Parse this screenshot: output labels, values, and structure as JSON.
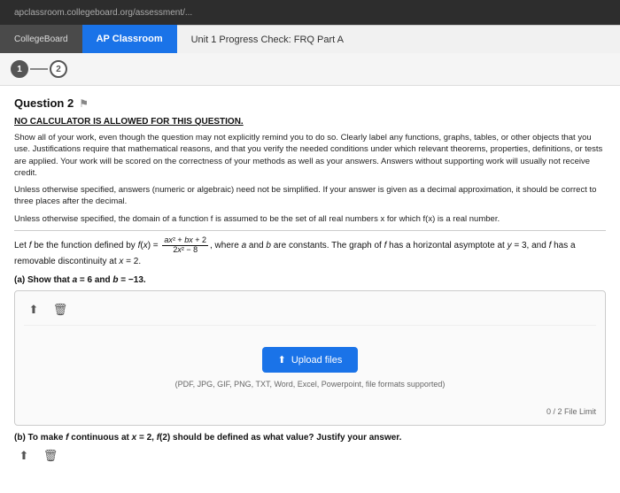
{
  "browser": {
    "url": "apclassroom.collegeboard.org/assessment/..."
  },
  "nav": {
    "collegeboard_label": "CollegeBoard",
    "ap_classroom_label": "AP Classroom",
    "page_title": "Unit 1 Progress Check: FRQ Part A"
  },
  "steps": {
    "step1_label": "1",
    "step2_label": "2"
  },
  "question": {
    "number": "Question 2",
    "no_calc_notice": "NO CALCULATOR IS ALLOWED FOR THIS QUESTION.",
    "instructions_1": "Show all of your work, even though the question may not explicitly remind you to do so. Clearly label any functions, graphs, tables, or other objects that you use. Justifications require that mathematical reasons, and that you verify the needed conditions under which relevant theorems, properties, definitions, or tests are applied. Your work will be scored on the correctness of your methods as well as your answers. Answers without supporting work will usually not receive credit.",
    "instructions_2": "Unless otherwise specified, answers (numeric or algebraic) need not be simplified. If your answer is given as a decimal approximation, it should be correct to three places after the decimal.",
    "instructions_3": "Unless otherwise specified, the domain of a function f is assumed to be the set of all real numbers x for which f(x) is a real number.",
    "problem_statement": "Let f be the function defined by f(x) = (ax² + bx + 2) / (2x² - 8), where a and b are constants. The graph of f has a horizontal asymptote at y = 3, and f has a removable discontinuity at x = 2.",
    "part_a_label": "(a) Show that a = 6 and b = −13.",
    "part_b_label": "(b) To make f continuous at x = 2, f(2) should be defined as what value? Justify your answer."
  },
  "upload": {
    "button_label": "Upload files",
    "formats_text": "(PDF, JPG, GIF, PNG, TXT, Word, Excel, Powerpoint, file formats supported)",
    "file_limit_text": "0 / 2 File Limit"
  },
  "toolbar": {
    "upload_icon": "⬆",
    "trash_icon": "🗑"
  }
}
